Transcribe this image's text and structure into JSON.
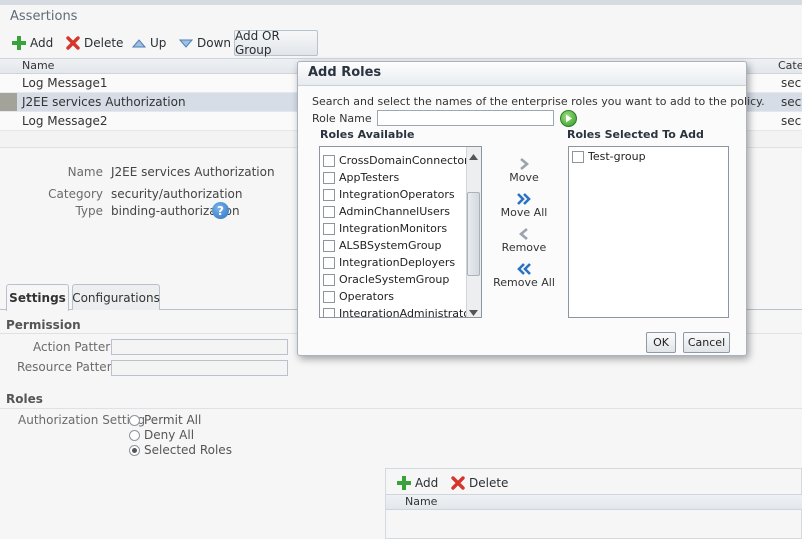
{
  "assertions": {
    "title": "Assertions",
    "toolbar": {
      "add": "Add",
      "delete": "Delete",
      "up": "Up",
      "down": "Down",
      "add_or_group": "Add OR Group"
    },
    "columns": {
      "name": "Name",
      "category": "Categ"
    },
    "rows": [
      {
        "name": "Log Message1",
        "category": "secu",
        "selected": false
      },
      {
        "name": "J2EE services Authorization",
        "category": "secu",
        "selected": true
      },
      {
        "name": "Log Message2",
        "category": "secu",
        "selected": false
      }
    ]
  },
  "details": {
    "name_label": "Name",
    "name_value": "J2EE services Authorization",
    "category_label": "Category",
    "category_value": "security/authorization",
    "type_label": "Type",
    "type_value": "binding-authorization"
  },
  "tabs": [
    {
      "label": "Settings",
      "active": true
    },
    {
      "label": "Configurations",
      "active": false
    }
  ],
  "permission": {
    "title": "Permission",
    "action_pattern_label": "Action Pattern",
    "resource_pattern_label": "Resource Pattern"
  },
  "roles": {
    "title": "Roles",
    "authorization_setting_label": "Authorization Setting",
    "options": [
      {
        "label": "Permit All",
        "selected": false
      },
      {
        "label": "Deny All",
        "selected": false
      },
      {
        "label": "Selected Roles",
        "selected": true
      }
    ],
    "toolbar": {
      "add": "Add",
      "delete": "Delete"
    },
    "column_name": "Name"
  },
  "dialog": {
    "title": "Add Roles",
    "instructions": "Search and select the names of the enterprise roles you want to add to the policy.",
    "role_name_label": "Role Name",
    "role_name_value": "",
    "available_title": "Roles Available",
    "selected_title": "Roles Selected To Add",
    "available_roles": [
      "CrossDomainConnectors",
      "AppTesters",
      "IntegrationOperators",
      "AdminChannelUsers",
      "IntegrationMonitors",
      "ALSBSystemGroup",
      "IntegrationDeployers",
      "OracleSystemGroup",
      "Operators",
      "IntegrationAdministrators"
    ],
    "selected_roles": [
      "Test-group"
    ],
    "move": "Move",
    "move_all": "Move All",
    "remove": "Remove",
    "remove_all": "Remove All",
    "ok": "OK",
    "cancel": "Cancel"
  },
  "colors": {
    "accent_blue": "#2a72c2",
    "add_green": "#3aa23a",
    "delete_red": "#d6352c",
    "selected_row": "#d6dde6"
  }
}
